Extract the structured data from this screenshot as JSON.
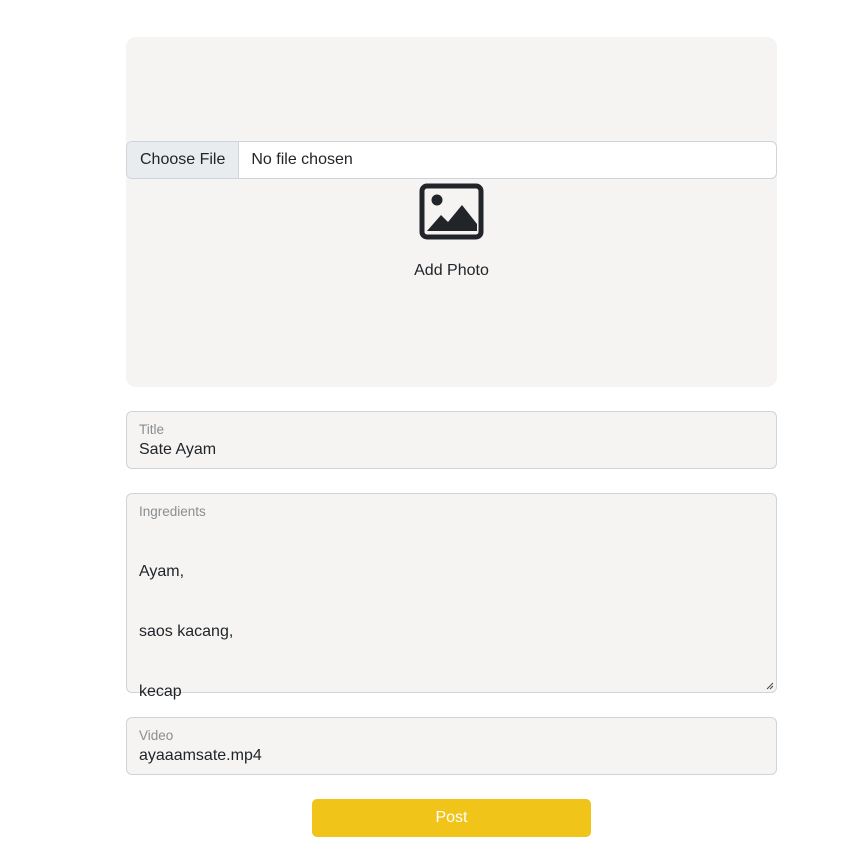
{
  "photo": {
    "file_button_label": "Choose File",
    "file_status": "No file chosen",
    "add_photo_label": "Add Photo",
    "icon": "image-icon"
  },
  "title": {
    "label": "Title",
    "value": "Sate Ayam"
  },
  "ingredients": {
    "label": "Ingredients",
    "lines": [
      "Ayam,",
      "saos kacang,",
      "kecap"
    ]
  },
  "video": {
    "label": "Video",
    "value": "ayaaamsate.mp4"
  },
  "post_button": {
    "label": "Post"
  },
  "colors": {
    "accent": "#f0c419",
    "field_background": "#f5f4f2",
    "border": "#ced4da"
  }
}
